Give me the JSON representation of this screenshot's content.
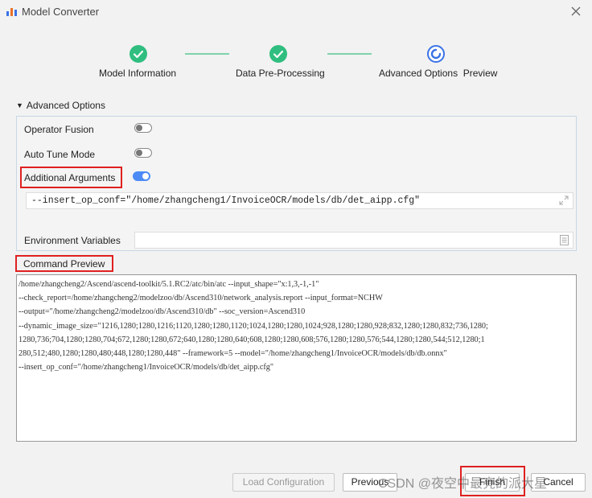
{
  "window": {
    "title": "Model Converter"
  },
  "stepper": {
    "steps": [
      {
        "label": "Model Information",
        "state": "done"
      },
      {
        "label": "Data Pre-Processing",
        "state": "done"
      },
      {
        "label": "Advanced Options  Preview",
        "state": "active"
      }
    ]
  },
  "advanced": {
    "header": "Advanced Options",
    "operator_fusion": {
      "label": "Operator Fusion",
      "enabled": false
    },
    "auto_tune": {
      "label": "Auto Tune Mode",
      "enabled": false
    },
    "additional_args": {
      "label": "Additional Arguments",
      "enabled": true,
      "value": "--insert_op_conf=\"/home/zhangcheng1/InvoiceOCR/models/db/det_aipp.cfg\""
    },
    "env_vars": {
      "label": "Environment Variables",
      "value": ""
    }
  },
  "command_preview": {
    "label": "Command Preview",
    "lines": [
      "/home/zhangcheng2/Ascend/ascend-toolkit/5.1.RC2/atc/bin/atc  --input_shape=\"x:1,3,-1,-1\"",
      "--check_report=/home/zhangcheng2/modelzoo/db/Ascend310/network_analysis.report --input_format=NCHW",
      "--output=\"/home/zhangcheng2/modelzoo/db/Ascend310/db\" --soc_version=Ascend310",
      "--dynamic_image_size=\"1216,1280;1280,1216;1120,1280;1280,1120;1024,1280;1280,1024;928,1280;1280,928;832,1280;1280,832;736,1280;",
      "1280,736;704,1280;1280,704;672,1280;1280,672;640,1280;1280,640;608,1280;1280,608;576,1280;1280,576;544,1280;1280,544;512,1280;1",
      "280,512;480,1280;1280,480;448,1280;1280,448\" --framework=5 --model=\"/home/zhangcheng1/InvoiceOCR/models/db/db.onnx\"",
      "--insert_op_conf=\"/home/zhangcheng1/InvoiceOCR/models/db/det_aipp.cfg\""
    ]
  },
  "buttons": {
    "load_configuration": "Load Configuration",
    "previous": "Previous",
    "finish": "Finish",
    "cancel": "Cancel"
  },
  "watermark": "CSDN @夜空中最亮的派大星",
  "colors": {
    "accent": "#4c8bf5",
    "success": "#2fbe7f",
    "highlight": "#e02020"
  }
}
